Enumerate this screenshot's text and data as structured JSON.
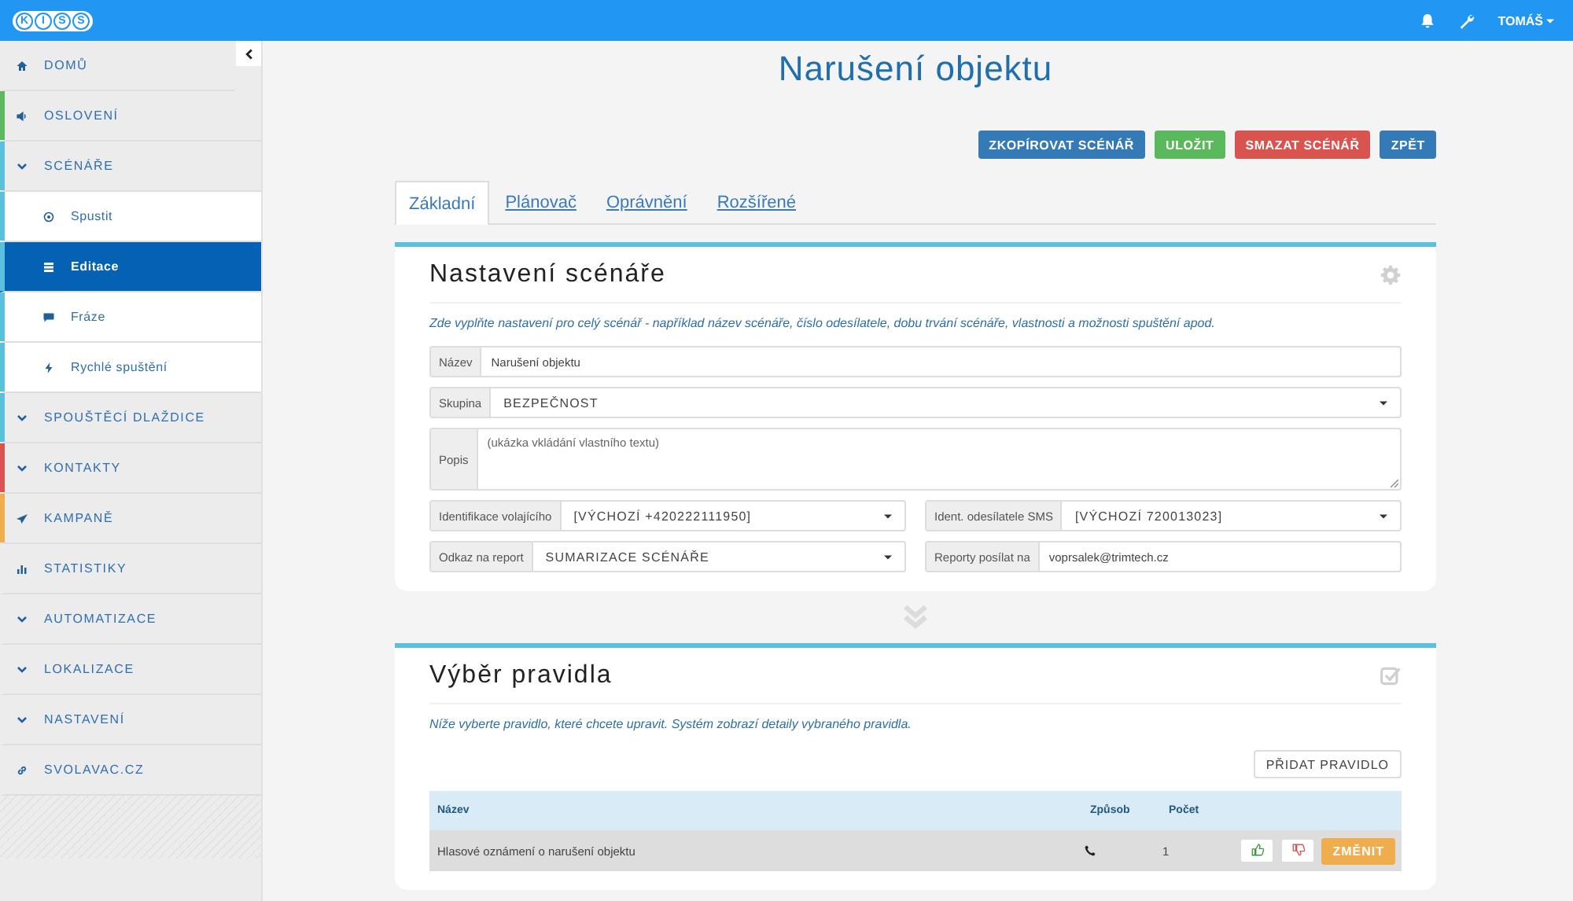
{
  "topbar": {
    "logo": [
      "K",
      "I",
      "S",
      "S"
    ],
    "user": "TOMÁŠ"
  },
  "sidebar": {
    "items": [
      {
        "label": "DOMŮ",
        "kind": "home",
        "selected": false
      },
      {
        "label": "OSLOVENÍ",
        "kind": "speaker",
        "selected": false,
        "color": "#5cb85c"
      },
      {
        "label": "SCÉNÁŘE",
        "kind": "group",
        "selected": false,
        "color": "#5bc0de",
        "children": [
          {
            "label": "Spustit",
            "kind": "target",
            "selected": false
          },
          {
            "label": "Editace",
            "kind": "list",
            "selected": true
          },
          {
            "label": "Fráze",
            "kind": "chat",
            "selected": false
          },
          {
            "label": "Rychlé spuštění",
            "kind": "bolt",
            "selected": false
          }
        ]
      },
      {
        "label": "SPOUŠTĚCÍ DLAŽDICE",
        "kind": "group",
        "selected": false,
        "color": "#5bc0de"
      },
      {
        "label": "KONTAKTY",
        "kind": "group",
        "selected": false,
        "color": "#d9534f"
      },
      {
        "label": "KAMPANĚ",
        "kind": "send",
        "selected": false,
        "color": "#f0ad4e"
      },
      {
        "label": "STATISTIKY",
        "kind": "chart",
        "selected": false
      },
      {
        "label": "AUTOMATIZACE",
        "kind": "group",
        "selected": false
      },
      {
        "label": "LOKALIZACE",
        "kind": "group",
        "selected": false
      },
      {
        "label": "NASTAVENÍ",
        "kind": "group",
        "selected": false
      },
      {
        "label": "SVOLAVAC.CZ",
        "kind": "link",
        "selected": false
      }
    ]
  },
  "page": {
    "title": "Narušení objektu",
    "actions": [
      {
        "label": "ZKOPÍROVAT SCÉNÁŘ",
        "color": "#337ab7"
      },
      {
        "label": "ULOŽIT",
        "color": "#5cb85c"
      },
      {
        "label": "SMAZAT SCÉNÁŘ",
        "color": "#d9534f"
      },
      {
        "label": "ZPĚT",
        "color": "#337ab7"
      }
    ],
    "tabs": [
      {
        "label": "Základní",
        "selected": true
      },
      {
        "label": "Plánovač",
        "selected": false
      },
      {
        "label": "Oprávnění",
        "selected": false
      },
      {
        "label": "Rozšířené",
        "selected": false
      }
    ]
  },
  "settings": {
    "title": "Nastavení scénáře",
    "description": "Zde vyplňte nastavení pro celý scénář - například název scénáře, číslo odesílatele, dobu trvání scénáře, vlastnosti a možnosti spuštění apod.",
    "rows": [
      [
        {
          "label": "Název",
          "value": "Narušení objektu",
          "kind": "text"
        }
      ],
      [
        {
          "label": "Skupina",
          "value": "BEZPEČNOST",
          "kind": "select"
        }
      ],
      [
        {
          "label": "Popis",
          "value": "(ukázka vkládání vlastního textu)",
          "kind": "textarea"
        }
      ],
      [
        {
          "label": "Identifikace volajícího",
          "value": "[VÝCHOZÍ +420222111950]",
          "kind": "select"
        },
        {
          "label": "Ident. odesílatele SMS",
          "value": "[VÝCHOZÍ 720013023]",
          "kind": "select"
        }
      ],
      [
        {
          "label": "Odkaz na report",
          "value": "SUMARIZACE SCÉNÁŘE",
          "kind": "select"
        },
        {
          "label": "Reporty posílat na",
          "value": "voprsalek@trimtech.cz",
          "kind": "text"
        }
      ]
    ]
  },
  "rules": {
    "title": "Výběr pravidla",
    "description": "Níže vyberte pravidlo, které chcete upravit. Systém zobrazí detaily vybraného pravidla.",
    "add_button": "PŘIDAT PRAVIDLO",
    "columns": [
      "Název",
      "Způsob",
      "Počet"
    ],
    "rows": [
      {
        "name": "Hlasové oznámení o narušení objektu",
        "count": "1",
        "action": "ZMĚNIT"
      }
    ]
  }
}
